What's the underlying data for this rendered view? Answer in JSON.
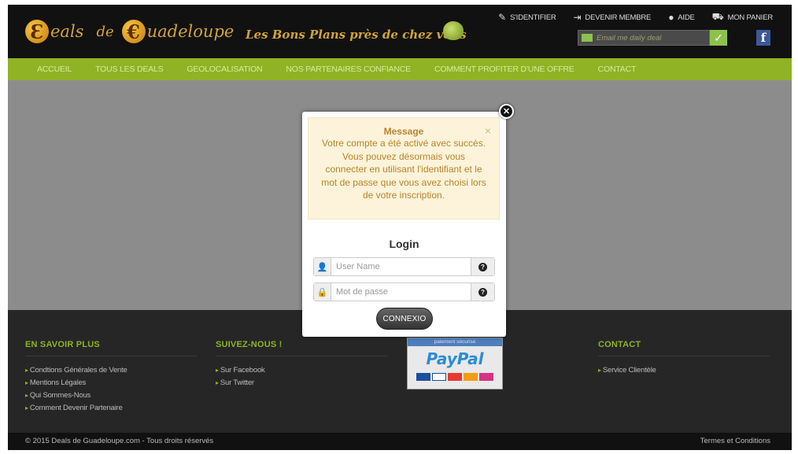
{
  "header": {
    "logo_words": [
      "eals",
      "de",
      "uadeloupe"
    ],
    "tagline": "Les Bons Plans près de chez vous",
    "toplinks": [
      {
        "label": "S'IDENTIFIER",
        "icon": "pencil-icon"
      },
      {
        "label": "DEVENIR MEMBRE",
        "icon": "signin-icon"
      },
      {
        "label": "AIDE",
        "icon": "help-icon"
      },
      {
        "label": "MON PANIER",
        "icon": "basket-icon"
      }
    ],
    "subscribe_placeholder": "Email me daily deal",
    "facebook_letter": "f"
  },
  "nav": [
    "ACCUEIL",
    "TOUS LES DEALS",
    "GEOLOCALISATION",
    "NOS PARTENAIRES CONFIANCE",
    "COMMENT PROFITER D'UNE OFFRE",
    "CONTACT"
  ],
  "modal": {
    "alert_title": "Message",
    "alert_message": "Votre compte a été activé avec succès. Vous pouvez désormais vous connecter en utilisant l'identifiant et le mot de passe que vous avez choisi lors de votre inscription.",
    "alert_close": "×",
    "login_title": "Login",
    "username_placeholder": "User Name",
    "password_placeholder": "Mot de passe",
    "submit_label": "CONNEXIO",
    "field_hint": "?"
  },
  "footer": {
    "col1": {
      "title": "EN SAVOIR PLUS",
      "items": [
        "Condtions Générales de Vente",
        "Mentions Légales",
        "Qui Sommes-Nous",
        "Comment Devenir Partenaire"
      ]
    },
    "col2": {
      "title": "SUIVEZ-NOUS !",
      "items": [
        "Sur Facebook",
        "Sur Twitter"
      ]
    },
    "paypal_top": "paiement sécurisé",
    "paypal_word": "PayPal",
    "col4": {
      "title": "CONTACT",
      "items": [
        "Service Clientèle"
      ]
    },
    "copyright": "© 2015 Deals de Guadeloupe.com - Tous droits réservés",
    "terms": "Termes et Conditions"
  },
  "colors": {
    "accent": "#8fb324",
    "brand_gold": "#d2a33a",
    "alert_bg": "#fcf3da"
  }
}
